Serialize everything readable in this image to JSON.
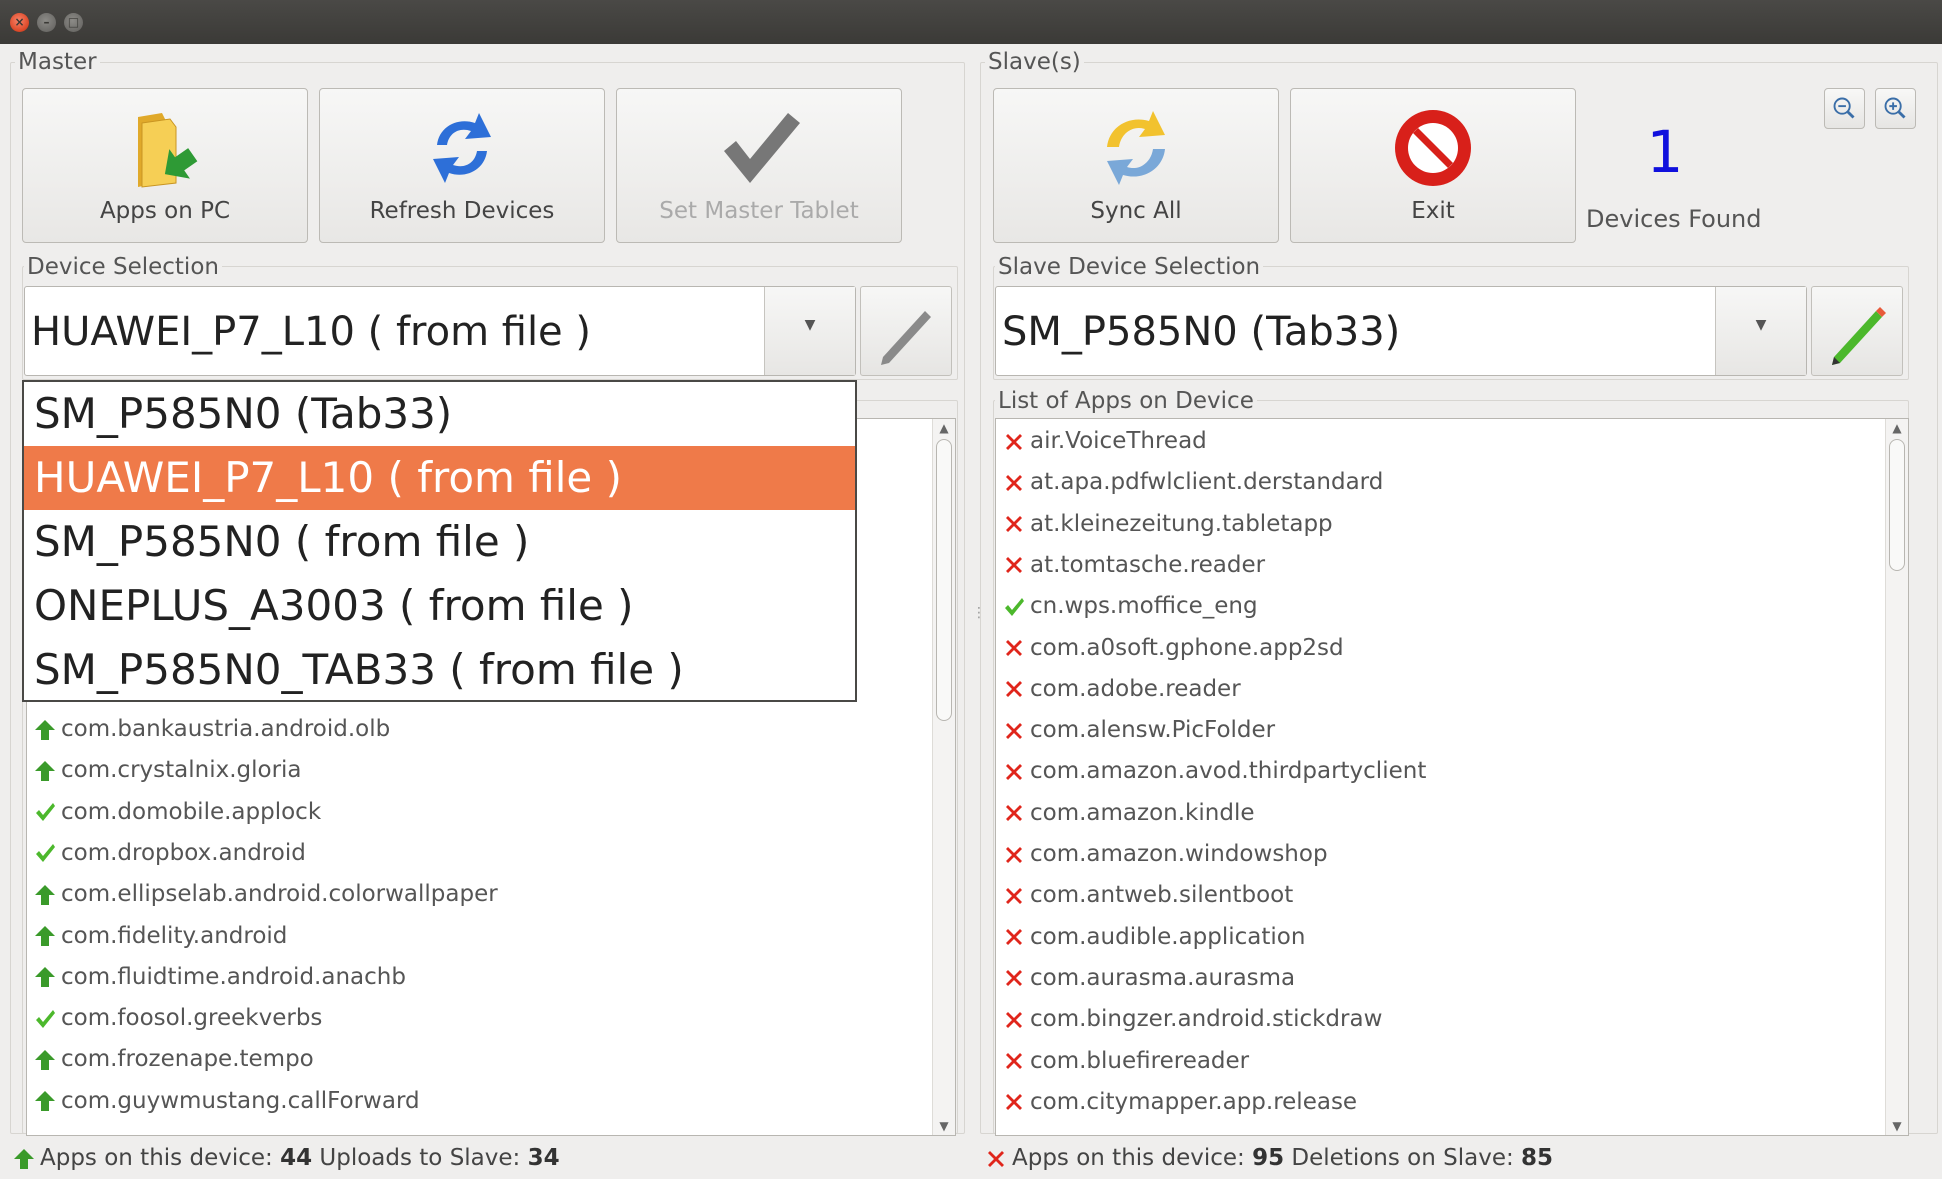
{
  "master": {
    "group_label": "Master",
    "buttons": {
      "apps_on_pc": "Apps on PC",
      "refresh_devices": "Refresh Devices",
      "set_master_tablet": "Set Master Tablet"
    },
    "device_selection_label": "Device Selection",
    "selected_device": "HUAWEI_P7_L10 ( from file )",
    "dropdown_options": [
      "SM_P585N0 (Tab33)",
      "HUAWEI_P7_L10 ( from file )",
      "SM_P585N0 ( from file )",
      "ONEPLUS_A3003 ( from file )",
      "SM_P585N0_TAB33 ( from file )"
    ],
    "apps": [
      {
        "name": "com.bankaustria.android.olb",
        "status": "upload"
      },
      {
        "name": "com.crystalnix.gloria",
        "status": "upload"
      },
      {
        "name": "com.domobile.applock",
        "status": "ok"
      },
      {
        "name": "com.dropbox.android",
        "status": "ok"
      },
      {
        "name": "com.ellipselab.android.colorwallpaper",
        "status": "upload"
      },
      {
        "name": "com.fidelity.android",
        "status": "upload"
      },
      {
        "name": "com.fluidtime.android.anachb",
        "status": "upload"
      },
      {
        "name": "com.foosol.greekverbs",
        "status": "ok"
      },
      {
        "name": "com.frozenape.tempo",
        "status": "upload"
      },
      {
        "name": "com.guywmustang.callForward",
        "status": "upload"
      }
    ],
    "status": {
      "apps_label": "Apps on this device:",
      "apps_count": "44",
      "uploads_label": "Uploads to Slave:",
      "uploads_count": "34"
    }
  },
  "slave": {
    "group_label": "Slave(s)",
    "buttons": {
      "sync_all": "Sync All",
      "exit": "Exit"
    },
    "devices_found_count": "1",
    "devices_found_label": "Devices Found",
    "device_selection_label": "Slave Device Selection",
    "selected_device": "SM_P585N0 (Tab33)",
    "list_label": "List of Apps on Device",
    "apps": [
      {
        "name": "air.VoiceThread",
        "status": "delete"
      },
      {
        "name": "at.apa.pdfwlclient.derstandard",
        "status": "delete"
      },
      {
        "name": "at.kleinezeitung.tabletapp",
        "status": "delete"
      },
      {
        "name": "at.tomtasche.reader",
        "status": "delete"
      },
      {
        "name": "cn.wps.moffice_eng",
        "status": "ok"
      },
      {
        "name": "com.a0soft.gphone.app2sd",
        "status": "delete"
      },
      {
        "name": "com.adobe.reader",
        "status": "delete"
      },
      {
        "name": "com.alensw.PicFolder",
        "status": "delete"
      },
      {
        "name": "com.amazon.avod.thirdpartyclient",
        "status": "delete"
      },
      {
        "name": "com.amazon.kindle",
        "status": "delete"
      },
      {
        "name": "com.amazon.windowshop",
        "status": "delete"
      },
      {
        "name": "com.antweb.silentboot",
        "status": "delete"
      },
      {
        "name": "com.audible.application",
        "status": "delete"
      },
      {
        "name": "com.aurasma.aurasma",
        "status": "delete"
      },
      {
        "name": "com.bingzer.android.stickdraw",
        "status": "delete"
      },
      {
        "name": "com.bluefirereader",
        "status": "delete"
      },
      {
        "name": "com.citymapper.app.release",
        "status": "delete"
      }
    ],
    "status": {
      "apps_label": "Apps on this device:",
      "apps_count": "95",
      "deletions_label": "Deletions on Slave:",
      "deletions_count": "85"
    }
  },
  "colors": {
    "selection": "#ef7a49",
    "delete_red": "#e0251b",
    "ok_green": "#4cb82c",
    "upload_green": "#3a9a2a",
    "count_blue": "#1010dd"
  }
}
